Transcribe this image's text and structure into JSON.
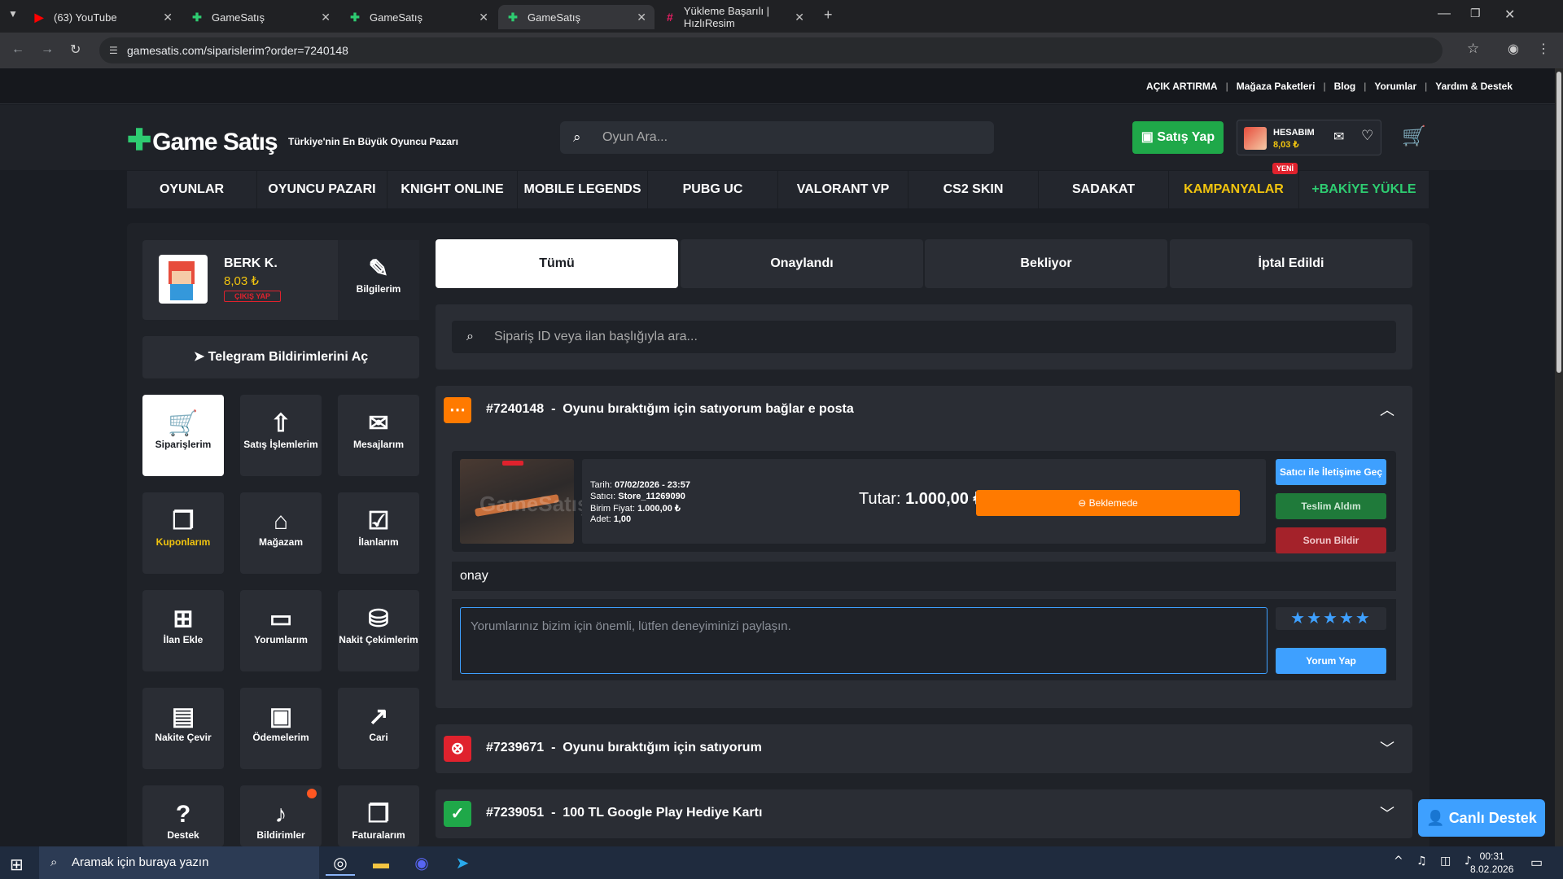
{
  "browser": {
    "tabs": [
      {
        "title": "(63) YouTube",
        "icon": "youtube-icon",
        "color": "#ff0000"
      },
      {
        "title": "GameSatış",
        "icon": "gamesatis-icon",
        "color": "#2ecc71"
      },
      {
        "title": "GameSatış",
        "icon": "gamesatis-icon",
        "color": "#2ecc71"
      },
      {
        "title": "GameSatış",
        "icon": "gamesatis-icon",
        "color": "#2ecc71"
      },
      {
        "title": "Yükleme Başarılı | HızlıResim",
        "icon": "hizliresim-icon",
        "color": "#e91e63"
      }
    ],
    "url": "gamesatis.com/siparislerim?order=7240148"
  },
  "site": {
    "top_links": [
      "AÇIK ARTIRMA",
      "Mağaza Paketleri",
      "Blog",
      "Yorumlar",
      "Yardım & Destek"
    ],
    "logo": "Game Satış",
    "slogan": "Türkiye'nin En Büyük Oyuncu Pazarı",
    "search_placeholder": "Oyun Ara...",
    "sell_button": "Satış Yap",
    "account_label": "HESABIM",
    "account_balance": "8,03 ₺",
    "menu": [
      "OYUNLAR",
      "OYUNCU PAZARI",
      "KNIGHT ONLINE",
      "MOBILE LEGENDS",
      "PUBG UC",
      "VALORANT VP",
      "CS2 SKIN",
      "SADAKAT",
      "KAMPANYALAR",
      "+BAKİYE YÜKLE"
    ],
    "new_badge": "YENİ",
    "accent_green": "#2ecc71",
    "accent_gold": "#f1c40f"
  },
  "profile": {
    "name": "BERK K.",
    "balance": "8,03 ₺",
    "logout": "ÇIKIŞ YAP",
    "info_label": "Bilgilerim"
  },
  "telegram_label": "Telegram Bildirimlerini Aç",
  "tiles": [
    {
      "label": "Siparişlerim",
      "icon": "cart-icon"
    },
    {
      "label": "Satış İşlemlerim",
      "icon": "cart-up-icon"
    },
    {
      "label": "Mesajlarım",
      "icon": "mail-icon"
    },
    {
      "label": "Kuponlarım",
      "icon": "coupon-icon"
    },
    {
      "label": "Mağazam",
      "icon": "store-icon"
    },
    {
      "label": "İlanlarım",
      "icon": "checklist-icon"
    },
    {
      "label": "İlan Ekle",
      "icon": "add-listing-icon"
    },
    {
      "label": "Yorumlarım",
      "icon": "comment-icon"
    },
    {
      "label": "Nakit Çekimlerim",
      "icon": "coins-icon"
    },
    {
      "label": "Nakite Çevir",
      "icon": "wallet-icon"
    },
    {
      "label": "Ödemelerim",
      "icon": "payment-icon"
    },
    {
      "label": "Cari",
      "icon": "chart-icon"
    },
    {
      "label": "Destek",
      "icon": "help-icon"
    },
    {
      "label": "Bildirimler",
      "icon": "bell-icon"
    },
    {
      "label": "Faturalarım",
      "icon": "invoice-icon"
    }
  ],
  "filters": [
    "Tümü",
    "Onaylandı",
    "Bekliyor",
    "İptal Edildi"
  ],
  "order_search_placeholder": "Sipariş ID veya ilan başlığıyla ara...",
  "orders": [
    {
      "id": "#7240148",
      "title": "Oyunu bıraktığım için satıyorum bağlar e posta",
      "status": "pending",
      "color": "#ff7a00"
    },
    {
      "id": "#7239671",
      "title": "Oyunu bıraktığım için satıyorum",
      "status": "cancelled",
      "color": "#e0222d"
    },
    {
      "id": "#7239051",
      "title": "100 TL Google Play Hediye Kartı",
      "status": "approved",
      "color": "#1fa849"
    }
  ],
  "order_detail": {
    "date_label": "Tarih:",
    "date": "07/02/2026 - 23:57",
    "seller_label": "Satıcı:",
    "seller": "Store_11269090",
    "unit_label": "Birim Fiyat:",
    "unit_price": "1.000,00 ₺",
    "qty_label": "Adet:",
    "qty": "1,00",
    "total_label": "Tutar:",
    "total": "1.000,00 ₺",
    "status_label": "Beklemede",
    "contact_button": "Satıcı ile İletişime Geç",
    "received_button": "Teslim Aldım",
    "report_button": "Sorun Bildir",
    "note": "onay",
    "review_placeholder": "Yorumlarınız bizim için önemli, lütfen deneyiminizi paylaşın.",
    "rating": 5,
    "review_button": "Yorum Yap"
  },
  "live_support": "Canlı Destek",
  "taskbar": {
    "search_placeholder": "Aramak için buraya yazın",
    "time": "00:31",
    "date": "8.02.2026"
  }
}
